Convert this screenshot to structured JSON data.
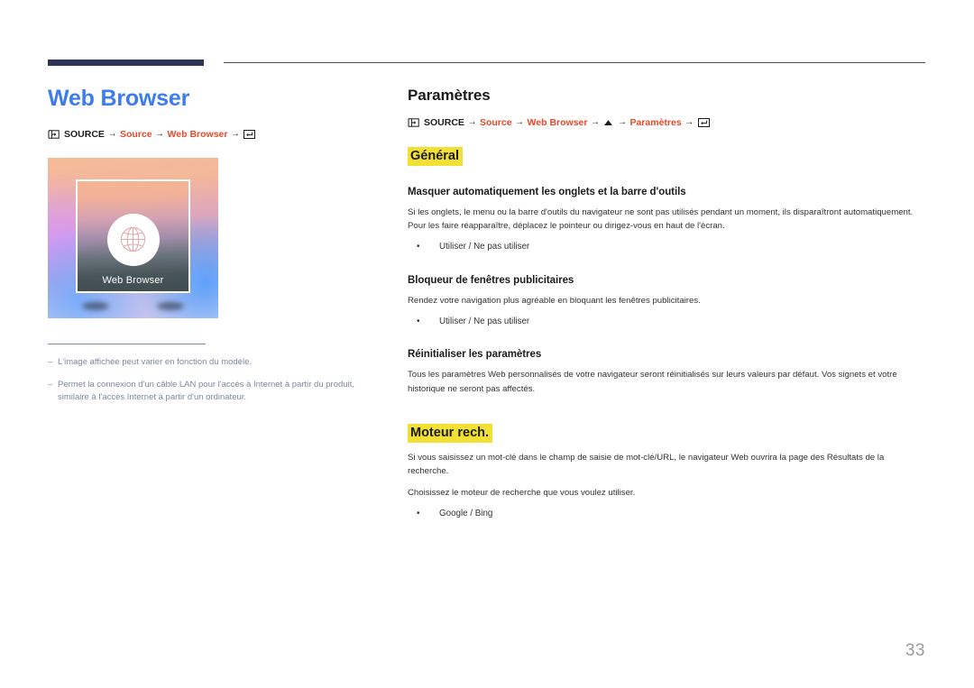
{
  "page": {
    "number": "33"
  },
  "left": {
    "title": "Web Browser",
    "breadcrumb": {
      "source_icon": "source-input-icon",
      "root": "SOURCE",
      "arrow": "→",
      "items": [
        "Source",
        "Web Browser"
      ],
      "enter_icon": "enter-key-icon"
    },
    "thumbnail": {
      "label": "Web Browser",
      "icon": "globe-icon"
    },
    "notes_dash": "–",
    "notes": [
      "L'image affichée peut varier en fonction du modèle.",
      "Permet la connexion d'un câble LAN pour l'accès à Internet à partir du produit, similaire à l'accès Internet à partir d'un ordinateur."
    ]
  },
  "right": {
    "title": "Paramètres",
    "breadcrumb": {
      "source_icon": "source-input-icon",
      "root": "SOURCE",
      "arrow": "→",
      "item1": "Source",
      "item2": "Web Browser",
      "up_icon": "triangle-up-icon",
      "item3": "Paramètres",
      "enter_icon": "enter-key-icon"
    },
    "general_heading": "Général",
    "sections": [
      {
        "heading": "Masquer automatiquement les onglets et la barre d'outils",
        "paragraph": "Si les onglets, le menu ou la barre d'outils du navigateur ne sont pas utilisés pendant un moment, ils disparaîtront automatiquement. Pour les faire réapparaître, déplacez le pointeur ou dirigez-vous en haut de l'écran.",
        "bullets": [
          "Utiliser / Ne pas utiliser"
        ]
      },
      {
        "heading": "Bloqueur de fenêtres publicitaires",
        "paragraph": "Rendez votre navigation plus agréable en bloquant les fenêtres publicitaires.",
        "bullets": [
          "Utiliser / Ne pas utiliser"
        ]
      },
      {
        "heading": "Réinitialiser les paramètres",
        "paragraph": "Tous les paramètres Web personnalisés de votre navigateur seront réinitialisés sur leurs valeurs par défaut. Vos signets et votre historique ne seront pas affectés.",
        "bullets": []
      }
    ],
    "engine_heading": "Moteur rech.",
    "engine_paragraph1": "Si vous saisissez un mot-clé dans le champ de saisie de mot-clé/URL, le navigateur Web ouvrira la page des Résultats de la recherche.",
    "engine_paragraph2": "Choisissez le moteur de recherche que vous voulez utiliser.",
    "engine_bullets": [
      "Google / Bing"
    ]
  },
  "colors": {
    "title_blue": "#3b7ded",
    "crumb_orange": "#e8492a",
    "highlight_yellow": "#f2e035",
    "rule_navy": "#2f3356",
    "note_gray": "#7e88a0"
  }
}
